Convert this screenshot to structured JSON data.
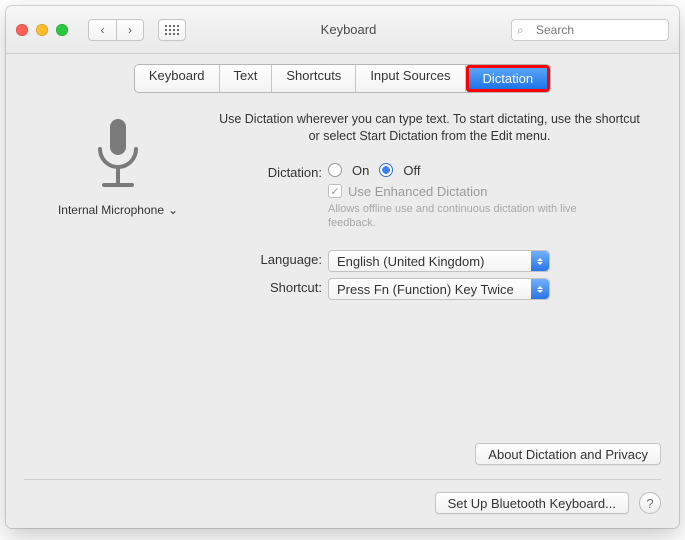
{
  "window": {
    "title": "Keyboard"
  },
  "search": {
    "placeholder": "Search"
  },
  "tabs": [
    "Keyboard",
    "Text",
    "Shortcuts",
    "Input Sources",
    "Dictation"
  ],
  "active_tab_index": 4,
  "mic": {
    "label": "Internal Microphone"
  },
  "intro": "Use Dictation wherever you can type text. To start dictating, use the shortcut or select Start Dictation from the Edit menu.",
  "dictation": {
    "label": "Dictation:",
    "on": "On",
    "off": "Off",
    "selected": "off",
    "enhanced_label": "Use Enhanced Dictation",
    "enhanced_checked": true,
    "enhanced_hint": "Allows offline use and continuous dictation with live feedback."
  },
  "language": {
    "label": "Language:",
    "value": "English (United Kingdom)"
  },
  "shortcut": {
    "label": "Shortcut:",
    "value": "Press Fn (Function) Key Twice"
  },
  "about_button": "About Dictation and Privacy",
  "bluetooth_button": "Set Up Bluetooth Keyboard...",
  "icons": {
    "back": "‹",
    "forward": "›",
    "chevron_down": "⌄",
    "check": "✓",
    "search": "⌕",
    "help": "?"
  },
  "colors": {
    "accent": "#1e73e8",
    "highlight": "#ff0000"
  }
}
